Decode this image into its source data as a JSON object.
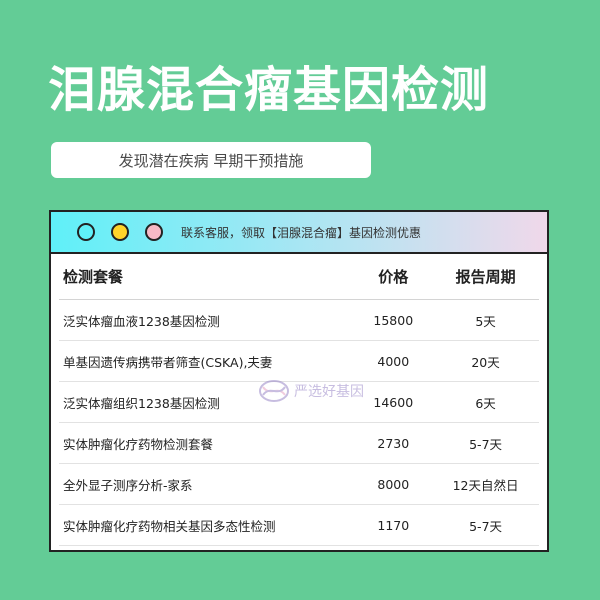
{
  "title": "泪腺混合瘤基因检测",
  "subtitle": "发现潜在疾病 早期干预措施",
  "window": {
    "bar_text": "联系客服，领取【泪腺混合瘤】基因检测优惠"
  },
  "table": {
    "headers": [
      "检测套餐",
      "价格",
      "报告周期"
    ],
    "rows": [
      [
        "泛实体瘤血液1238基因检测",
        "15800",
        "5天"
      ],
      [
        "单基因遗传病携带者筛查(CSKA),夫妻",
        "4000",
        "20天"
      ],
      [
        "泛实体瘤组织1238基因检测",
        "14600",
        "6天"
      ],
      [
        "实体肿瘤化疗药物检测套餐",
        "2730",
        "5-7天"
      ],
      [
        "全外显子测序分析-家系",
        "8000",
        "12天自然日"
      ],
      [
        "实体肿瘤化疗药物相关基因多态性检测",
        "1170",
        "5-7天"
      ]
    ]
  },
  "watermark": "严选好基因",
  "colors": {
    "background": "#63cc96",
    "dot_cyan": "#5ff0f8",
    "dot_yellow": "#ffd42a",
    "dot_pink": "#f7b9c6"
  }
}
